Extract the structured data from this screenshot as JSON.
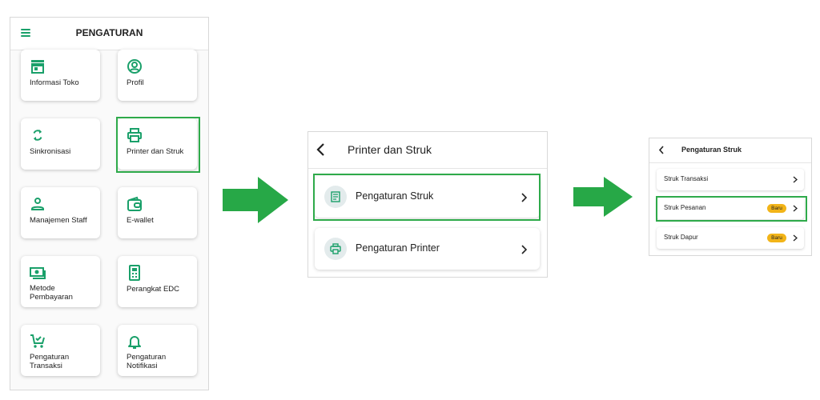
{
  "panel1": {
    "title": "PENGATURAN",
    "cards": [
      {
        "label": "Informasi Toko",
        "icon": "store-icon"
      },
      {
        "label": "Profil",
        "icon": "user-circle-icon"
      },
      {
        "label": "Sinkronisasi",
        "icon": "sync-icon"
      },
      {
        "label": "Printer dan Struk",
        "icon": "printer-icon"
      },
      {
        "label": "Manajemen Staff",
        "icon": "person-icon"
      },
      {
        "label": "E-wallet",
        "icon": "wallet-icon"
      },
      {
        "label": "Metode Pembayaran",
        "icon": "cash-icon"
      },
      {
        "label": "Perangkat EDC",
        "icon": "edc-device-icon"
      },
      {
        "label": "Pengaturan Transaksi",
        "icon": "cart-check-icon"
      },
      {
        "label": "Pengaturan Notifikasi",
        "icon": "bell-icon"
      }
    ]
  },
  "panel2": {
    "title": "Printer dan Struk",
    "rows": [
      {
        "label": "Pengaturan Struk",
        "icon": "receipt-icon"
      },
      {
        "label": "Pengaturan Printer",
        "icon": "printer-icon"
      }
    ]
  },
  "panel3": {
    "title": "Pengaturan Struk",
    "rows": [
      {
        "label": "Struk Transaksi",
        "badge": ""
      },
      {
        "label": "Struk Pesanan",
        "badge": "Baru"
      },
      {
        "label": "Struk Dapur",
        "badge": "Baru"
      }
    ]
  },
  "colors": {
    "accent": "#1aa06a",
    "highlight": "#2eaa4a",
    "badge": "#f2b418"
  }
}
